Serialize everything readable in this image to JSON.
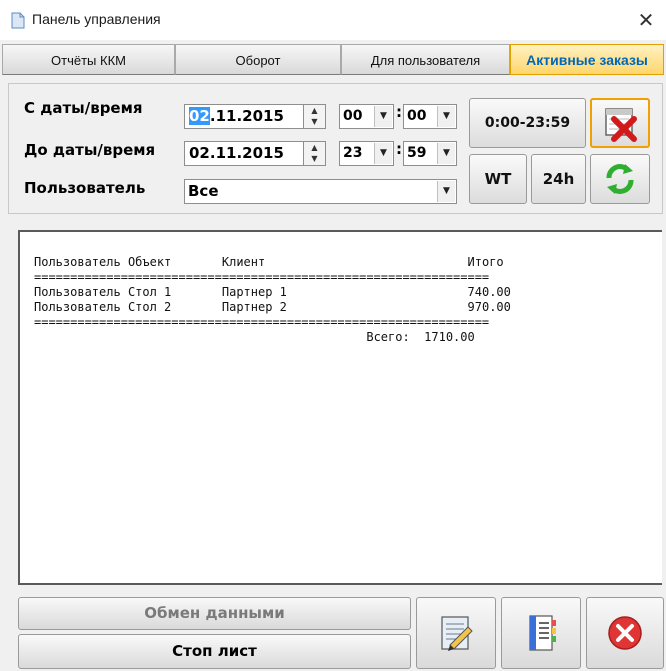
{
  "window": {
    "title": "Панель управления"
  },
  "tabs": [
    {
      "label": "Отчёты ККМ"
    },
    {
      "label": "Оборот"
    },
    {
      "label": "Для пользователя"
    },
    {
      "label": "Активные заказы"
    }
  ],
  "filter": {
    "from_label": "С даты/время",
    "from_date_selected": "02",
    "from_date_rest": ".11.2015",
    "from_hour": "00",
    "from_minute": "00",
    "to_label": "До даты/время",
    "to_date": "02.11.2015",
    "to_hour": "23",
    "to_minute": "59",
    "user_label": "Пользователь",
    "user_value": "Все",
    "range_button": "0:00-23:59",
    "wt_button": "WT",
    "h24_button": "24h",
    "separator": ":"
  },
  "report": {
    "headers": {
      "user": "Пользователь",
      "object": "Объект",
      "client": "Клиент",
      "total": "Итого"
    },
    "rows": [
      {
        "user": "Пользователь",
        "object": "Стол 1",
        "client": "Партнер 1",
        "total": "740.00"
      },
      {
        "user": "Пользователь",
        "object": "Стол 2",
        "client": "Партнер 2",
        "total": "970.00"
      }
    ],
    "grand_total_label": "Всего:",
    "grand_total_value": "1710.00"
  },
  "bottom": {
    "exchange_button": "Обмен данными",
    "stoplist_button": "Стоп лист"
  },
  "icons": {
    "clear": "clear-calendar-icon",
    "refresh": "refresh-icon",
    "report1": "report-edit-icon",
    "report2": "notepad-icon",
    "close": "close-icon"
  }
}
